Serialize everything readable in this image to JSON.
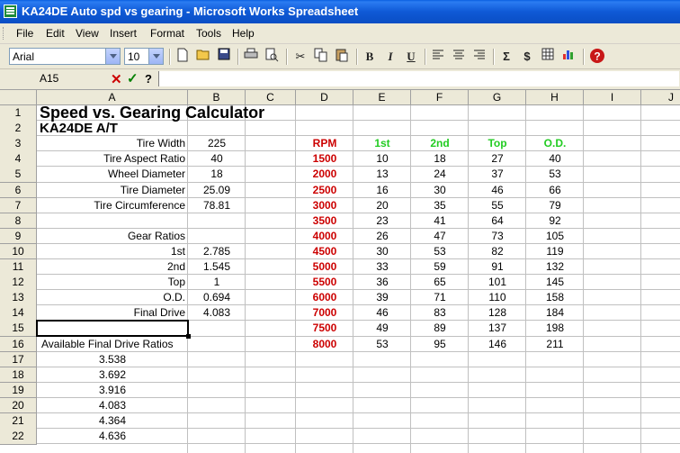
{
  "window": {
    "title": "KA24DE Auto spd vs gearing - Microsoft Works Spreadsheet"
  },
  "menu": [
    "File",
    "Edit",
    "View",
    "Insert",
    "Format",
    "Tools",
    "Help"
  ],
  "toolbar": {
    "font_name": "Arial",
    "font_size": "10",
    "bold_label": "B",
    "italic_label": "I",
    "underline_label": "U",
    "autosum_label": "Σ",
    "currency_label": "$",
    "help_label": "?"
  },
  "formula_bar": {
    "cell_ref": "A15",
    "cancel": "✕",
    "enter": "✓",
    "help": "?",
    "value": ""
  },
  "columns": [
    "A",
    "B",
    "C",
    "D",
    "E",
    "F",
    "G",
    "H",
    "I",
    "J"
  ],
  "rows": [
    "1",
    "2",
    "3",
    "4",
    "5",
    "6",
    "7",
    "8",
    "9",
    "10",
    "11",
    "12",
    "13",
    "14",
    "15",
    "16",
    "17",
    "18",
    "19",
    "20",
    "21",
    "22"
  ],
  "sheet": {
    "title": "Speed vs. Gearing Calculator",
    "subtitle": "KA24DE A/T",
    "params": [
      {
        "label": "Tire Width",
        "value": "225"
      },
      {
        "label": "Tire Aspect Ratio",
        "value": "40"
      },
      {
        "label": "Wheel Diameter",
        "value": "18"
      },
      {
        "label": "Tire Diameter",
        "value": "25.09"
      },
      {
        "label": "Tire Circumference",
        "value": "78.81"
      }
    ],
    "gear_ratios_label": "Gear Ratios",
    "gears": [
      {
        "label": "1st",
        "value": "2.785"
      },
      {
        "label": "2nd",
        "value": "1.545"
      },
      {
        "label": "Top",
        "value": "1"
      },
      {
        "label": "O.D.",
        "value": "0.694"
      },
      {
        "label": "Final Drive",
        "value": "4.083"
      }
    ],
    "final_drive_label": "Available Final Drive Ratios",
    "final_drive_ratios": [
      "3.538",
      "3.692",
      "3.916",
      "4.083",
      "4.364",
      "4.636"
    ],
    "speed_table": {
      "headers": [
        "RPM",
        "1st",
        "2nd",
        "Top",
        "O.D."
      ],
      "rows": [
        [
          "1500",
          "10",
          "18",
          "27",
          "40"
        ],
        [
          "2000",
          "13",
          "24",
          "37",
          "53"
        ],
        [
          "2500",
          "16",
          "30",
          "46",
          "66"
        ],
        [
          "3000",
          "20",
          "35",
          "55",
          "79"
        ],
        [
          "3500",
          "23",
          "41",
          "64",
          "92"
        ],
        [
          "4000",
          "26",
          "47",
          "73",
          "105"
        ],
        [
          "4500",
          "30",
          "53",
          "82",
          "119"
        ],
        [
          "5000",
          "33",
          "59",
          "91",
          "132"
        ],
        [
          "5500",
          "36",
          "65",
          "101",
          "145"
        ],
        [
          "6000",
          "39",
          "71",
          "110",
          "158"
        ],
        [
          "7000",
          "46",
          "83",
          "128",
          "184"
        ],
        [
          "7500",
          "49",
          "89",
          "137",
          "198"
        ],
        [
          "8000",
          "53",
          "95",
          "146",
          "211"
        ]
      ]
    }
  },
  "colors": {
    "rpm": "#cc0000",
    "gear_header": "#22cc22",
    "titlebar": "#0a4ec4"
  }
}
